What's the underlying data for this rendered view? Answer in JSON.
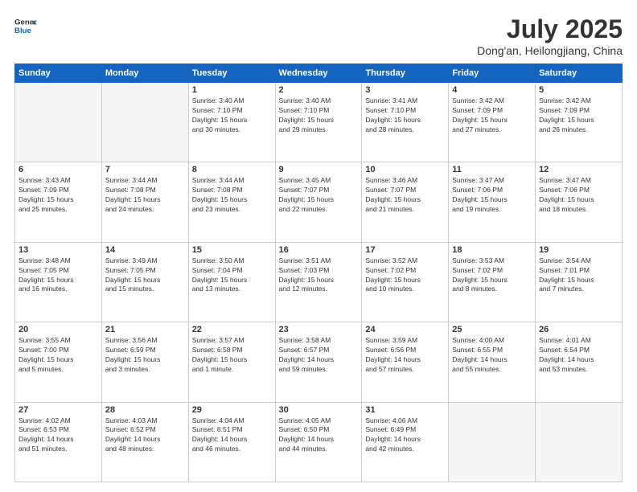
{
  "header": {
    "logo_line1": "General",
    "logo_line2": "Blue",
    "month_year": "July 2025",
    "location": "Dong'an, Heilongjiang, China"
  },
  "days_of_week": [
    "Sunday",
    "Monday",
    "Tuesday",
    "Wednesday",
    "Thursday",
    "Friday",
    "Saturday"
  ],
  "weeks": [
    [
      {
        "day": "",
        "info": ""
      },
      {
        "day": "",
        "info": ""
      },
      {
        "day": "1",
        "info": "Sunrise: 3:40 AM\nSunset: 7:10 PM\nDaylight: 15 hours\nand 30 minutes."
      },
      {
        "day": "2",
        "info": "Sunrise: 3:40 AM\nSunset: 7:10 PM\nDaylight: 15 hours\nand 29 minutes."
      },
      {
        "day": "3",
        "info": "Sunrise: 3:41 AM\nSunset: 7:10 PM\nDaylight: 15 hours\nand 28 minutes."
      },
      {
        "day": "4",
        "info": "Sunrise: 3:42 AM\nSunset: 7:09 PM\nDaylight: 15 hours\nand 27 minutes."
      },
      {
        "day": "5",
        "info": "Sunrise: 3:42 AM\nSunset: 7:09 PM\nDaylight: 15 hours\nand 26 minutes."
      }
    ],
    [
      {
        "day": "6",
        "info": "Sunrise: 3:43 AM\nSunset: 7:09 PM\nDaylight: 15 hours\nand 25 minutes."
      },
      {
        "day": "7",
        "info": "Sunrise: 3:44 AM\nSunset: 7:08 PM\nDaylight: 15 hours\nand 24 minutes."
      },
      {
        "day": "8",
        "info": "Sunrise: 3:44 AM\nSunset: 7:08 PM\nDaylight: 15 hours\nand 23 minutes."
      },
      {
        "day": "9",
        "info": "Sunrise: 3:45 AM\nSunset: 7:07 PM\nDaylight: 15 hours\nand 22 minutes."
      },
      {
        "day": "10",
        "info": "Sunrise: 3:46 AM\nSunset: 7:07 PM\nDaylight: 15 hours\nand 21 minutes."
      },
      {
        "day": "11",
        "info": "Sunrise: 3:47 AM\nSunset: 7:06 PM\nDaylight: 15 hours\nand 19 minutes."
      },
      {
        "day": "12",
        "info": "Sunrise: 3:47 AM\nSunset: 7:06 PM\nDaylight: 15 hours\nand 18 minutes."
      }
    ],
    [
      {
        "day": "13",
        "info": "Sunrise: 3:48 AM\nSunset: 7:05 PM\nDaylight: 15 hours\nand 16 minutes."
      },
      {
        "day": "14",
        "info": "Sunrise: 3:49 AM\nSunset: 7:05 PM\nDaylight: 15 hours\nand 15 minutes."
      },
      {
        "day": "15",
        "info": "Sunrise: 3:50 AM\nSunset: 7:04 PM\nDaylight: 15 hours\nand 13 minutes."
      },
      {
        "day": "16",
        "info": "Sunrise: 3:51 AM\nSunset: 7:03 PM\nDaylight: 15 hours\nand 12 minutes."
      },
      {
        "day": "17",
        "info": "Sunrise: 3:52 AM\nSunset: 7:02 PM\nDaylight: 15 hours\nand 10 minutes."
      },
      {
        "day": "18",
        "info": "Sunrise: 3:53 AM\nSunset: 7:02 PM\nDaylight: 15 hours\nand 8 minutes."
      },
      {
        "day": "19",
        "info": "Sunrise: 3:54 AM\nSunset: 7:01 PM\nDaylight: 15 hours\nand 7 minutes."
      }
    ],
    [
      {
        "day": "20",
        "info": "Sunrise: 3:55 AM\nSunset: 7:00 PM\nDaylight: 15 hours\nand 5 minutes."
      },
      {
        "day": "21",
        "info": "Sunrise: 3:56 AM\nSunset: 6:59 PM\nDaylight: 15 hours\nand 3 minutes."
      },
      {
        "day": "22",
        "info": "Sunrise: 3:57 AM\nSunset: 6:58 PM\nDaylight: 15 hours\nand 1 minute."
      },
      {
        "day": "23",
        "info": "Sunrise: 3:58 AM\nSunset: 6:57 PM\nDaylight: 14 hours\nand 59 minutes."
      },
      {
        "day": "24",
        "info": "Sunrise: 3:59 AM\nSunset: 6:56 PM\nDaylight: 14 hours\nand 57 minutes."
      },
      {
        "day": "25",
        "info": "Sunrise: 4:00 AM\nSunset: 6:55 PM\nDaylight: 14 hours\nand 55 minutes."
      },
      {
        "day": "26",
        "info": "Sunrise: 4:01 AM\nSunset: 6:54 PM\nDaylight: 14 hours\nand 53 minutes."
      }
    ],
    [
      {
        "day": "27",
        "info": "Sunrise: 4:02 AM\nSunset: 6:53 PM\nDaylight: 14 hours\nand 51 minutes."
      },
      {
        "day": "28",
        "info": "Sunrise: 4:03 AM\nSunset: 6:52 PM\nDaylight: 14 hours\nand 48 minutes."
      },
      {
        "day": "29",
        "info": "Sunrise: 4:04 AM\nSunset: 6:51 PM\nDaylight: 14 hours\nand 46 minutes."
      },
      {
        "day": "30",
        "info": "Sunrise: 4:05 AM\nSunset: 6:50 PM\nDaylight: 14 hours\nand 44 minutes."
      },
      {
        "day": "31",
        "info": "Sunrise: 4:06 AM\nSunset: 6:49 PM\nDaylight: 14 hours\nand 42 minutes."
      },
      {
        "day": "",
        "info": ""
      },
      {
        "day": "",
        "info": ""
      }
    ]
  ]
}
